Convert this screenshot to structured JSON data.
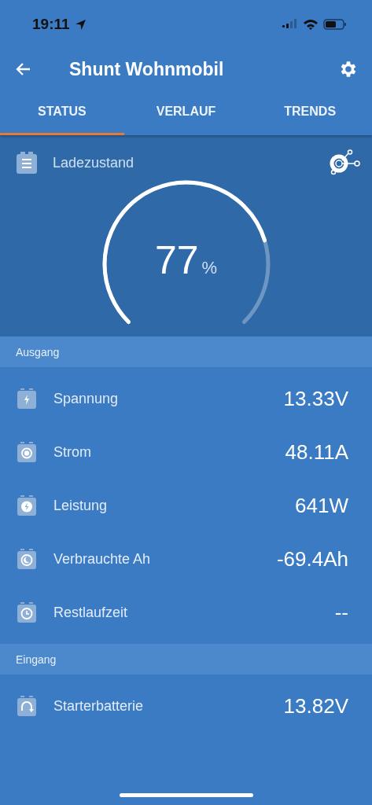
{
  "status_bar": {
    "time": "19:11"
  },
  "app_bar": {
    "title": "Shunt Wohnmobil"
  },
  "tabs": [
    {
      "label": "STATUS",
      "selected": true
    },
    {
      "label": "VERLAUF",
      "selected": false
    },
    {
      "label": "TRENDS",
      "selected": false
    }
  ],
  "gauge": {
    "label": "Ladezustand",
    "value": "77",
    "unit": "%"
  },
  "sections": [
    {
      "title": "Ausgang",
      "rows": [
        {
          "kind": "bolt",
          "label": "Spannung",
          "value": "13.33V"
        },
        {
          "kind": "target",
          "label": "Strom",
          "value": "48.11A"
        },
        {
          "kind": "power",
          "label": "Leistung",
          "value": "641W"
        },
        {
          "kind": "moon",
          "label": "Verbrauchte Ah",
          "value": "-69.4Ah"
        },
        {
          "kind": "clock",
          "label": "Restlaufzeit",
          "value": "--"
        }
      ]
    },
    {
      "title": "Eingang",
      "rows": [
        {
          "kind": "cycle",
          "label": "Starterbatterie",
          "value": "13.82V"
        }
      ]
    }
  ]
}
